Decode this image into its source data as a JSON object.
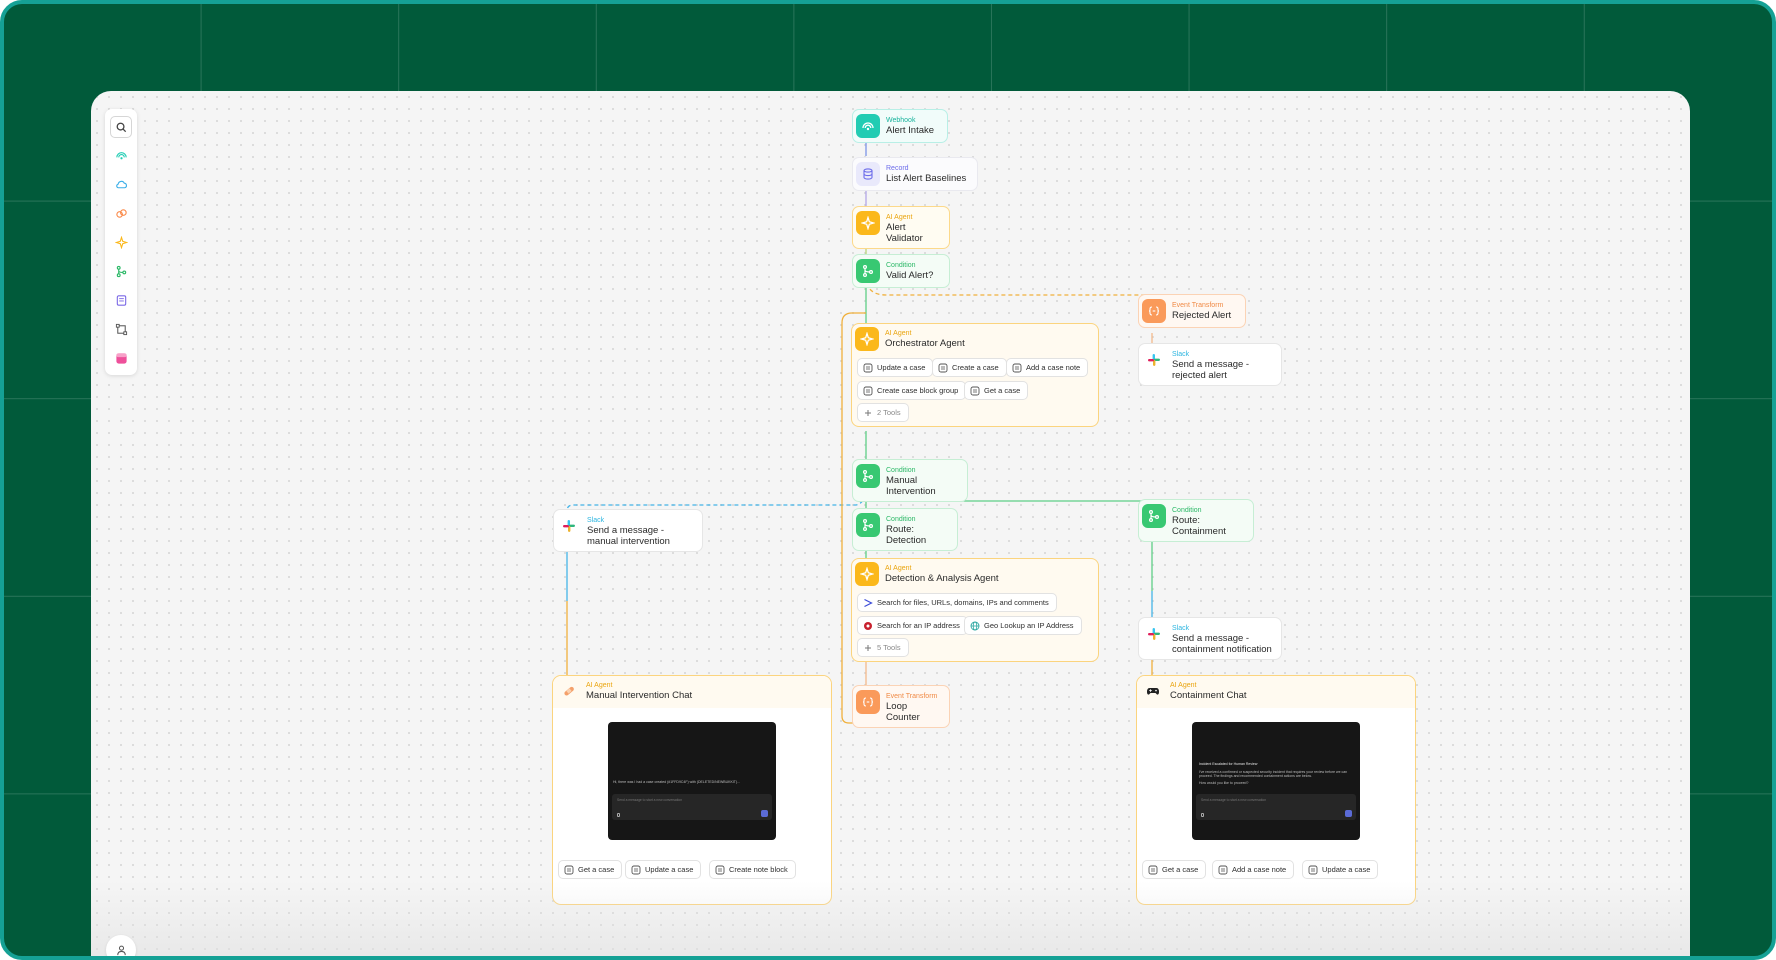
{
  "colors": {
    "frame_green": "#015a3a",
    "frame_border": "#15a195",
    "webhook": "#21ccb3",
    "ai_agent": "#fbb81b",
    "condition": "#38c872",
    "transform": "#fa9a5a",
    "slack_blue": "#2cb5e0",
    "record": "#6c6cea"
  },
  "toolbar": {
    "items": [
      "search-icon",
      "webhook-icon",
      "cloud-icon",
      "transform-icon",
      "ai-agent-icon",
      "branch-icon",
      "note-icon",
      "frame-icon",
      "app-icon"
    ]
  },
  "nodes": {
    "webhook": {
      "type": "Webhook",
      "title": "Alert Intake"
    },
    "record": {
      "type": "Record",
      "title": "List Alert Baselines"
    },
    "validator": {
      "type": "AI Agent",
      "title": "Alert Validator"
    },
    "valid": {
      "type": "Condition",
      "title": "Valid Alert?"
    },
    "rejected": {
      "type": "Event Transform",
      "title": "Rejected Alert"
    },
    "slack_rejected": {
      "type": "Slack",
      "title": "Send a message - rejected alert"
    },
    "manual_cond": {
      "type": "Condition",
      "title": "Manual Intervention"
    },
    "slack_manual": {
      "type": "Slack",
      "title": "Send a message - manual intervention"
    },
    "route_detection": {
      "type": "Condition",
      "title": "Route: Detection"
    },
    "route_containment": {
      "type": "Condition",
      "title": "Route: Containment"
    },
    "slack_containment": {
      "type": "Slack",
      "title": "Send a message - containment notification"
    },
    "loop": {
      "type": "Event Transform",
      "title": "Loop Counter"
    }
  },
  "orchestrator": {
    "type": "AI Agent",
    "title": "Orchestrator Agent",
    "tools": [
      "Update a case",
      "Create a case",
      "Add a case note",
      "Create case block group",
      "Get a case"
    ],
    "more": "2 Tools"
  },
  "detection": {
    "type": "AI Agent",
    "title": "Detection & Analysis Agent",
    "tools": [
      "Search for files, URLs, domains, IPs and comments",
      "Search for an IP address",
      "Geo Lookup an IP Address"
    ],
    "more": "5 Tools"
  },
  "manual_chat": {
    "type": "AI Agent",
    "title": "Manual Intervention Chat",
    "screen_text": "Hi, there was I had a case created (#1FFD9C4F) with (DELETED/NEWBUKKIT)...",
    "composer_placeholder": "Send a message to start a new conversation",
    "tools": [
      "Get a case",
      "Update a case",
      "Create note block"
    ]
  },
  "containment_chat": {
    "type": "AI Agent",
    "title": "Containment Chat",
    "screen_lines": [
      "Incident Escalated for Human Review",
      "I've received a confirmed or suspected security incident that requires your review before we can",
      "proceed. The findings and recommended containment actions are below.",
      "How would you like to proceed?"
    ],
    "composer_placeholder": "Send a message to start a new conversation",
    "tools": [
      "Get a case",
      "Add a case note",
      "Update a case"
    ]
  }
}
